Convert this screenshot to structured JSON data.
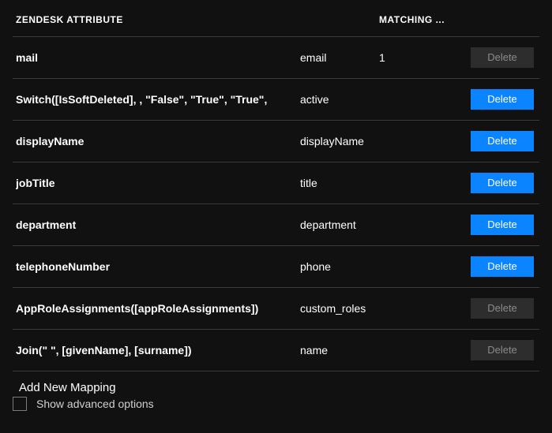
{
  "headers": {
    "source": "ZENDESK ATTRIBUTE",
    "target": "",
    "matching": "MATCHING ..."
  },
  "rows": [
    {
      "source": "mail",
      "target": "email",
      "matching": "1",
      "delete_label": "Delete",
      "delete_active": false
    },
    {
      "source": "Switch([IsSoftDeleted], , \"False\", \"True\", \"True\",",
      "target": "active",
      "matching": "",
      "delete_label": "Delete",
      "delete_active": true
    },
    {
      "source": "displayName",
      "target": "displayName",
      "matching": "",
      "delete_label": "Delete",
      "delete_active": true
    },
    {
      "source": "jobTitle",
      "target": "title",
      "matching": "",
      "delete_label": "Delete",
      "delete_active": true
    },
    {
      "source": "department",
      "target": "department",
      "matching": "",
      "delete_label": "Delete",
      "delete_active": true
    },
    {
      "source": "telephoneNumber",
      "target": "phone",
      "matching": "",
      "delete_label": "Delete",
      "delete_active": true
    },
    {
      "source": "AppRoleAssignments([appRoleAssignments])",
      "target": "custom_roles",
      "matching": "",
      "delete_label": "Delete",
      "delete_active": false
    },
    {
      "source": "Join(\" \", [givenName], [surname])",
      "target": "name",
      "matching": "",
      "delete_label": "Delete",
      "delete_active": false
    }
  ],
  "add_mapping_label": "Add New Mapping",
  "footer": {
    "show_advanced_label": "Show advanced options"
  },
  "colors": {
    "accent": "#0a84ff"
  }
}
